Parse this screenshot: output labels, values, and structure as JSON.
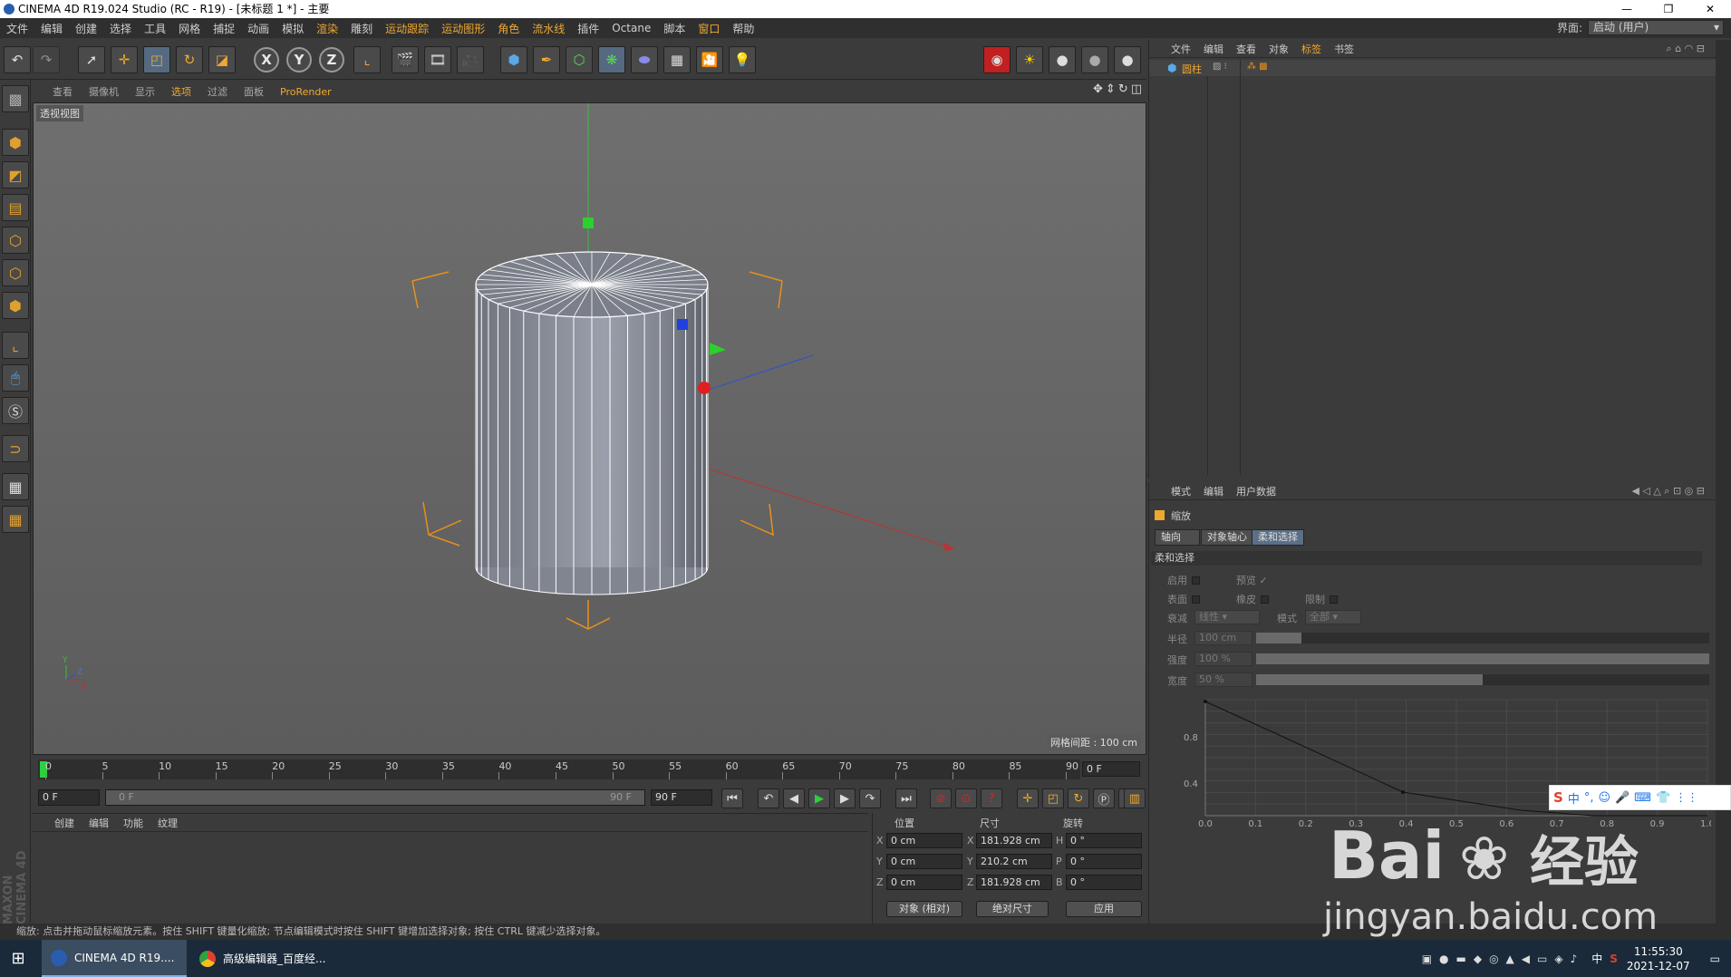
{
  "window": {
    "title": "CINEMA 4D R19.024 Studio (RC - R19) - [未标题 1 *] - 主要",
    "controls": [
      "—",
      "❐",
      "✕"
    ]
  },
  "menu": {
    "items": [
      "文件",
      "编辑",
      "创建",
      "选择",
      "工具",
      "网格",
      "捕捉",
      "动画",
      "模拟",
      "渲染",
      "雕刻",
      "运动跟踪",
      "运动图形",
      "角色",
      "流水线",
      "插件",
      "Octane",
      "脚本",
      "窗口",
      "帮助"
    ],
    "layout_label": "界面:",
    "layout_value": "启动 (用户)"
  },
  "toolbar": {
    "axis": [
      "X",
      "Y",
      "Z"
    ]
  },
  "viewport": {
    "menu": [
      "查看",
      "摄像机",
      "显示",
      "选项",
      "过滤",
      "面板",
      "ProRender"
    ],
    "label": "透视视图",
    "grid_spacing": "网格间距 : 100 cm",
    "axis_labels": {
      "y": "Y",
      "z": "Z",
      "x": "X"
    }
  },
  "timeline": {
    "ticks": [
      "0",
      "5",
      "10",
      "15",
      "20",
      "25",
      "30",
      "35",
      "40",
      "45",
      "50",
      "55",
      "60",
      "65",
      "70",
      "75",
      "80",
      "85",
      "90"
    ],
    "current_frame": "0 F",
    "start_field": "0 F",
    "range_start": "0 F",
    "range_end": "90 F",
    "end_field": "90 F"
  },
  "material_manager": {
    "menu": [
      "创建",
      "编辑",
      "功能",
      "纹理"
    ]
  },
  "coordinates": {
    "headers": {
      "position": "位置",
      "size": "尺寸",
      "rotation": "旋转"
    },
    "rows": [
      {
        "axis": "X",
        "pos": "0 cm",
        "saxis": "X",
        "size": "181.928 cm",
        "raxis": "H",
        "rot": "0 °"
      },
      {
        "axis": "Y",
        "pos": "0 cm",
        "saxis": "Y",
        "size": "210.2 cm",
        "raxis": "P",
        "rot": "0 °"
      },
      {
        "axis": "Z",
        "pos": "0 cm",
        "saxis": "Z",
        "size": "181.928 cm",
        "raxis": "B",
        "rot": "0 °"
      }
    ],
    "mode_button": "对象 (相对)",
    "size_button": "绝对尺寸",
    "apply_button": "应用"
  },
  "object_manager": {
    "menu": [
      "文件",
      "编辑",
      "查看",
      "对象",
      "标签",
      "书签"
    ],
    "object_name": "圆柱"
  },
  "attribute_manager": {
    "menu": [
      "模式",
      "编辑",
      "用户数据"
    ],
    "tool_name": "缩放",
    "tabs": [
      "轴向",
      "对象轴心",
      "柔和选择"
    ],
    "section": "柔和选择",
    "labels": {
      "enable": "启用",
      "preview": "预览",
      "surface": "表面",
      "rubber": "橡皮",
      "restrict": "限制",
      "falloff": "衰减",
      "falloff_value": "线性",
      "mode": "模式",
      "mode_value": "全部",
      "radius": "半径",
      "radius_value": "100 cm",
      "strength": "强度",
      "strength_value": "100 %",
      "width": "宽度",
      "width_value": "50 %"
    },
    "slider_levels": {
      "radius": 0.1,
      "strength": 1.0,
      "width": 0.5
    },
    "graph": {
      "y_ticks": [
        "0.8",
        "0.4"
      ],
      "x_ticks": [
        "0.0",
        "0.1",
        "0.2",
        "0.3",
        "0.4",
        "0.5",
        "0.6",
        "0.7",
        "0.8",
        "0.9",
        "1.0"
      ]
    }
  },
  "status_text": "缩放: 点击并拖动鼠标缩放元素。按住 SHIFT 键量化缩放; 节点编辑模式时按住 SHIFT 键增加选择对象; 按住 CTRL 键减少选择对象。",
  "maxon_logo": "MAXON CINEMA 4D",
  "taskbar": {
    "tasks": [
      {
        "label": "CINEMA 4D R19...."
      },
      {
        "label": "高级编辑器_百度经..."
      }
    ],
    "ime": "中",
    "time": "11:55:30",
    "date": "2021-12-07"
  },
  "ime_bar": {
    "lang": "中"
  },
  "watermark": {
    "brand": "Bai",
    "brand2": "经验",
    "url": "jingyan.baidu.com"
  }
}
